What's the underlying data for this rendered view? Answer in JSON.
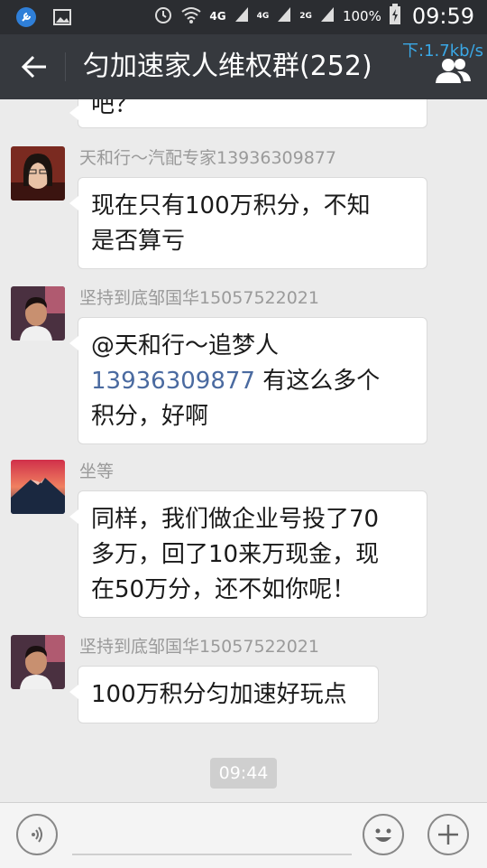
{
  "status_bar": {
    "network": "4G",
    "network2": "4G",
    "network3": "2G",
    "battery": "100%",
    "time": "09:59"
  },
  "header": {
    "back_icon": "back-arrow-icon",
    "title": "匀加速家人维权群(252)",
    "speed": "下:1.7kb/s",
    "members_icon": "group-members-icon"
  },
  "messages": [
    {
      "sender": "",
      "text": "吧？",
      "partial": true
    },
    {
      "sender": "天和行～汽配专家13936309877",
      "text_lines": [
        "现在只有100万积分，不知",
        "是否算亏"
      ]
    },
    {
      "sender": "坚持到底邹国华15057522021",
      "mention": "@天和行～追梦人",
      "mention_number": "13936309877",
      "text_after_number": " 有这么多个",
      "text_last": "积分，好啊"
    },
    {
      "sender": "坐等",
      "text_lines": [
        "同样，我们做企业号投了70",
        "多万，回了10来万现金，现",
        "在50万分，还不如你呢！"
      ]
    },
    {
      "sender": "坚持到底邹国华15057522021",
      "text_lines": [
        "100万积分匀加速好玩点"
      ]
    }
  ],
  "timestamp": "09:44",
  "input_bar": {
    "voice_icon": "voice-input-icon",
    "emoji_icon": "emoji-icon",
    "plus_icon": "plus-icon"
  }
}
